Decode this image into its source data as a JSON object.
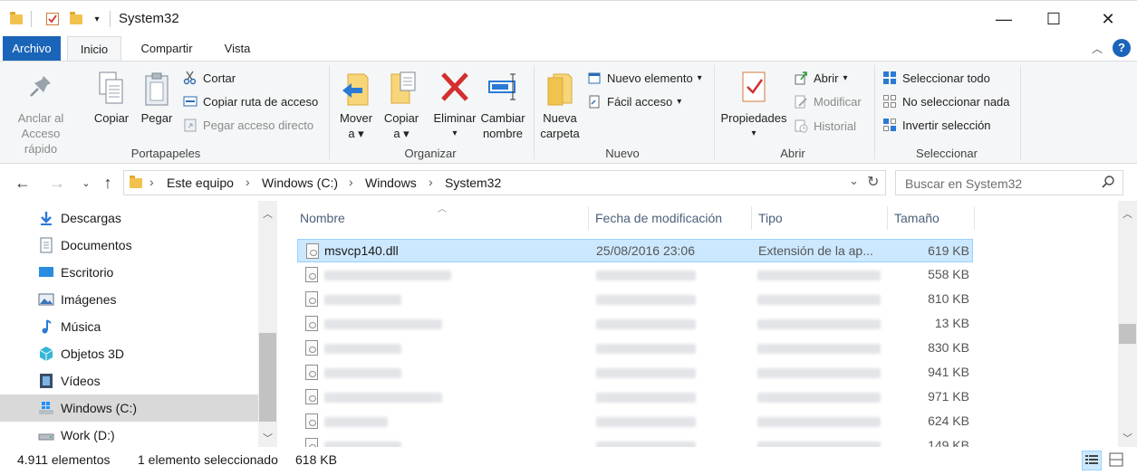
{
  "window": {
    "title": "System32",
    "minimize_symbol": "—",
    "maximize_symbol": "☐",
    "close_symbol": "✕"
  },
  "ribbon_tabs": [
    "Archivo",
    "Inicio",
    "Compartir",
    "Vista"
  ],
  "ribbon": {
    "portapapeles": {
      "label": "Portapapeles",
      "pin_label_1": "Anclar al",
      "pin_label_2": "Acceso rápido",
      "copy": "Copiar",
      "paste": "Pegar",
      "cut": "Cortar",
      "copy_path": "Copiar ruta de acceso",
      "paste_shortcut": "Pegar acceso directo"
    },
    "organizar": {
      "label": "Organizar",
      "move_1": "Mover",
      "move_2": "a",
      "copy_1": "Copiar",
      "copy_2": "a",
      "delete": "Eliminar",
      "rename_1": "Cambiar",
      "rename_2": "nombre"
    },
    "nuevo": {
      "label": "Nuevo",
      "new_folder_1": "Nueva",
      "new_folder_2": "carpeta",
      "new_item": "Nuevo elemento",
      "easy_access": "Fácil acceso"
    },
    "abrir": {
      "label": "Abrir",
      "properties": "Propiedades",
      "open": "Abrir",
      "edit": "Modificar",
      "history": "Historial"
    },
    "seleccionar": {
      "label": "Seleccionar",
      "select_all": "Seleccionar todo",
      "select_none": "No seleccionar nada",
      "invert": "Invertir selección"
    }
  },
  "address": {
    "crumbs": [
      "Este equipo",
      "Windows (C:)",
      "Windows",
      "System32"
    ],
    "search_placeholder": "Buscar en System32"
  },
  "nav_pane": [
    {
      "label": "Descargas",
      "icon": "download-arrow-icon"
    },
    {
      "label": "Documentos",
      "icon": "document-icon"
    },
    {
      "label": "Escritorio",
      "icon": "desktop-icon"
    },
    {
      "label": "Imágenes",
      "icon": "pictures-icon"
    },
    {
      "label": "Música",
      "icon": "music-note-icon"
    },
    {
      "label": "Objetos 3D",
      "icon": "cube-3d-icon"
    },
    {
      "label": "Vídeos",
      "icon": "film-icon"
    },
    {
      "label": "Windows (C:)",
      "icon": "windows-drive-icon"
    },
    {
      "label": "Work (D:)",
      "icon": "drive-icon"
    }
  ],
  "columns": {
    "name": "Nombre",
    "modified": "Fecha de modificación",
    "type": "Tipo",
    "size": "Tamaño"
  },
  "files": [
    {
      "name": "msvcp140.dll",
      "modified": "25/08/2016 23:06",
      "type": "Extensión de la ap...",
      "size": "619 KB"
    },
    {
      "name": "",
      "modified": "",
      "type": "",
      "size": "558 KB"
    },
    {
      "name": "",
      "modified": "",
      "type": "",
      "size": "810 KB"
    },
    {
      "name": "",
      "modified": "",
      "type": "",
      "size": "13 KB"
    },
    {
      "name": "",
      "modified": "",
      "type": "",
      "size": "830 KB"
    },
    {
      "name": "",
      "modified": "",
      "type": "",
      "size": "941 KB"
    },
    {
      "name": "",
      "modified": "",
      "type": "",
      "size": "971 KB"
    },
    {
      "name": "",
      "modified": "",
      "type": "",
      "size": "624 KB"
    },
    {
      "name": "",
      "modified": "",
      "type": "",
      "size": "149 KB"
    }
  ],
  "status": {
    "count": "4.911 elementos",
    "selected": "1 elemento seleccionado",
    "selected_size": "618 KB"
  },
  "colors": {
    "file_tab": "#1a65b9",
    "selection": "#cce8ff",
    "selection_border": "#99d1ff",
    "nav_selected": "#d9d9d9",
    "folder": "#f2c24e",
    "delete_red": "#d32f2f"
  }
}
